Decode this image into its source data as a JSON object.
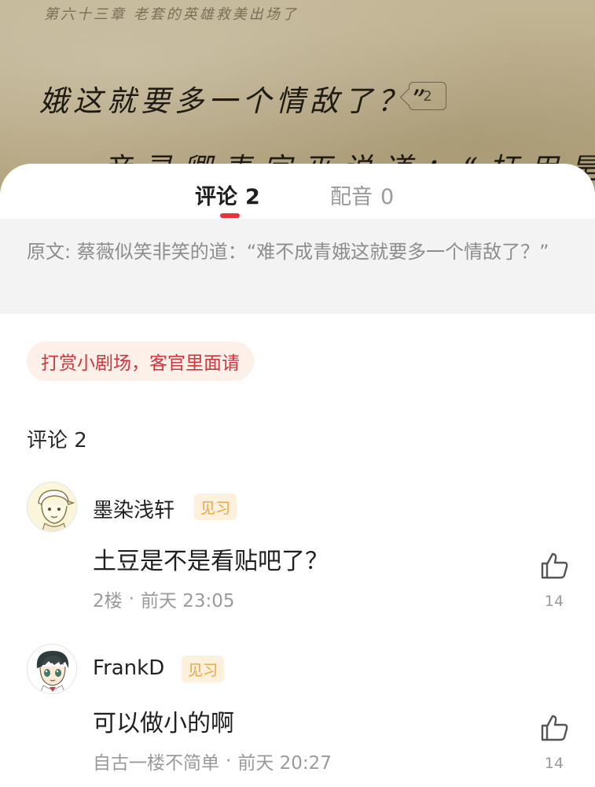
{
  "reader": {
    "chapter_header": "第六十三章 老套的英雄救美出场了",
    "line1": "娥这就要多一个情敌了？”",
    "paragraph_comment_count": "2",
    "line2": "彦灵卿表字巫说道：“枉用是"
  },
  "tabs": [
    {
      "label": "评论",
      "count": "2"
    },
    {
      "label": "配音",
      "count": "0"
    }
  ],
  "quote": {
    "text": "原文: 蔡薇似笑非笑的道：“难不成青娥这就要多一个情敌了？”"
  },
  "reward": {
    "label": "打赏小剧场，客官里面请"
  },
  "comments_section": {
    "title": "评论 2"
  },
  "comments": [
    {
      "username": "墨染浅轩",
      "level": "见习",
      "text": "土豆是不是看贴吧了？",
      "floor": "2楼",
      "time": "前天 23:05",
      "likes": "14",
      "avatar_icon": "anime-avatar-capboy-icon"
    },
    {
      "username": "FrankD",
      "level": "见习",
      "text": "可以做小的啊",
      "floor": "自古一楼不简单",
      "time": "前天 20:27",
      "likes": "14",
      "avatar_icon": "anime-avatar-boy-icon"
    }
  ],
  "colors": {
    "accent_red": "#e8333b",
    "badge_orange": "#efa43a",
    "reward_text": "#d0363b",
    "muted_text": "#9a9a9a"
  }
}
